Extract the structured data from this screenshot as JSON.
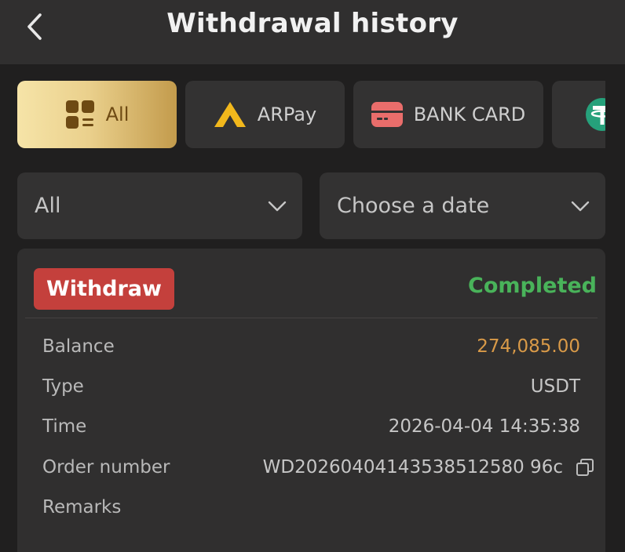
{
  "header": {
    "title": "Withdrawal history"
  },
  "tabs": [
    {
      "label": "All",
      "icon": "grid-list-icon",
      "active": true
    },
    {
      "label": "ARPay",
      "icon": "arpay-logo-icon",
      "active": false
    },
    {
      "label": "BANK CARD",
      "icon": "bank-card-icon",
      "active": false
    },
    {
      "label": "",
      "icon": "usdt-tether-icon",
      "active": false
    }
  ],
  "filters": {
    "status": {
      "value": "All"
    },
    "date": {
      "placeholder": "Choose a date"
    }
  },
  "records": [
    {
      "type": "Withdraw",
      "status": "Completed",
      "rows": {
        "balance": {
          "label": "Balance",
          "value": "274,085.00"
        },
        "type": {
          "label": "Type",
          "value": "USDT"
        },
        "time": {
          "label": "Time",
          "value": "2026-04-04 14:35:38"
        },
        "order": {
          "label": "Order number",
          "value": "WD20260404143538512580 96c"
        },
        "remarks": {
          "label": "Remarks",
          "value": ""
        }
      }
    }
  ],
  "colors": {
    "background": "#201f1f",
    "surface": "#333232",
    "accent_gold": "#e9cf8a",
    "withdraw_badge": "#c4403c",
    "completed": "#49b35a",
    "balance": "#d99a48",
    "arpay_yellow": "#f2b81c",
    "bank_card_red": "#e96d6b",
    "usdt_teal": "#26a17b"
  }
}
